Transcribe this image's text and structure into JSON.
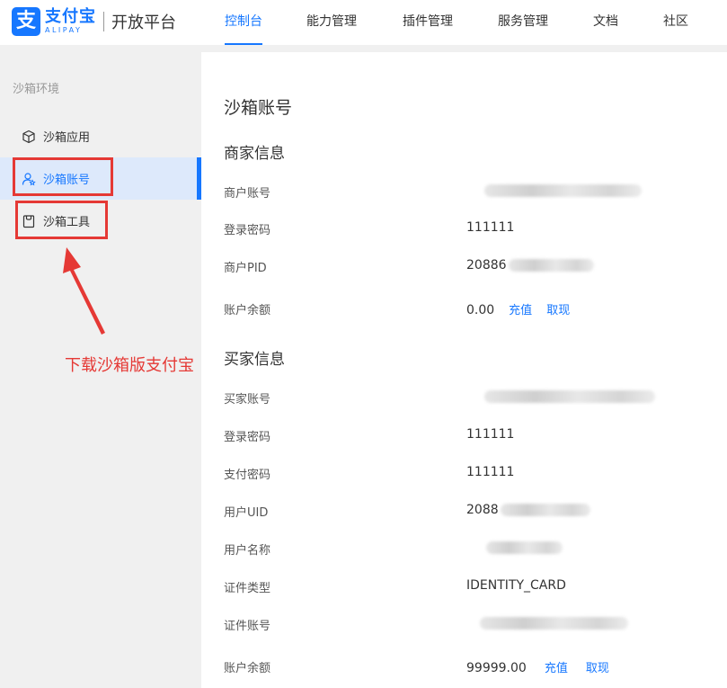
{
  "header": {
    "logo_cn": "支付宝",
    "logo_en": "ALIPAY",
    "platform": "开放平台",
    "nav": [
      "控制台",
      "能力管理",
      "插件管理",
      "服务管理",
      "文档",
      "社区"
    ],
    "active_nav": "控制台"
  },
  "sidebar": {
    "group_label": "沙箱环境",
    "items": [
      {
        "label": "沙箱应用",
        "icon": "cube-icon"
      },
      {
        "label": "沙箱账号",
        "icon": "user-star-icon"
      },
      {
        "label": "沙箱工具",
        "icon": "bag-icon"
      }
    ],
    "active_item": "沙箱账号"
  },
  "annotation": "下载沙箱版支付宝",
  "main": {
    "title": "沙箱账号",
    "merchant": {
      "title": "商家信息",
      "account_label": "商户账号",
      "password_label": "登录密码",
      "password_value": "111111",
      "pid_label": "商户PID",
      "pid_prefix": "20886",
      "balance_label": "账户余额",
      "balance_value": "0.00",
      "recharge": "充值",
      "withdraw": "取现"
    },
    "buyer": {
      "title": "买家信息",
      "account_label": "买家账号",
      "password_label": "登录密码",
      "password_value": "111111",
      "pay_password_label": "支付密码",
      "pay_password_value": "111111",
      "uid_label": "用户UID",
      "uid_prefix": "2088",
      "name_label": "用户名称",
      "id_type_label": "证件类型",
      "id_type_value": "IDENTITY_CARD",
      "id_number_label": "证件账号",
      "balance_label": "账户余额",
      "balance_value": "99999.00",
      "recharge": "充值",
      "withdraw": "取现"
    }
  },
  "colors": {
    "brand": "#1677ff",
    "annotation": "#e53935",
    "active_bg": "#dde9fb"
  }
}
